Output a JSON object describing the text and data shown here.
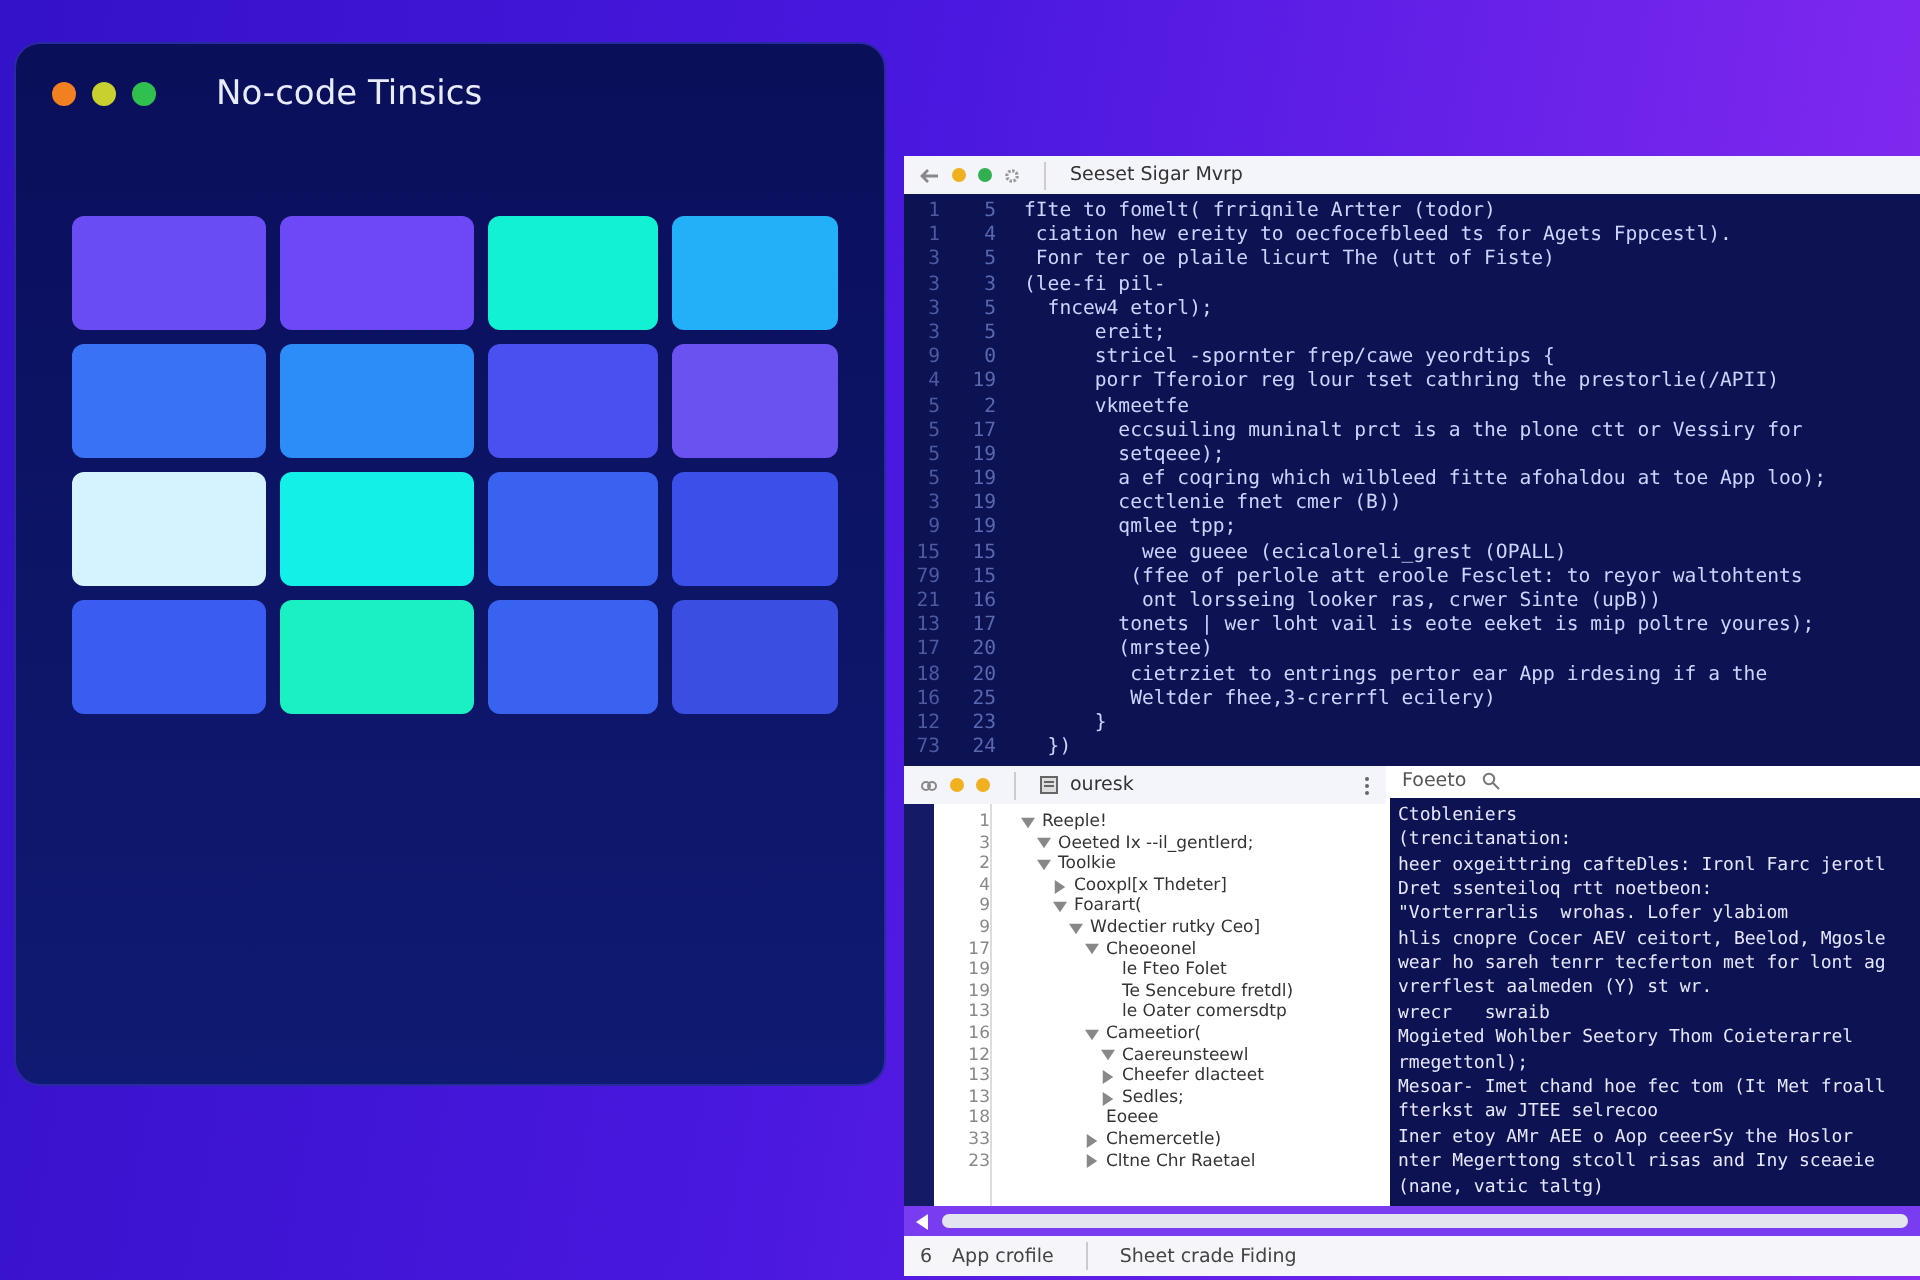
{
  "app_window": {
    "title": "No-code Tinsics",
    "tiles": [
      {
        "color": "#6a4cf5"
      },
      {
        "color": "#6c48f6"
      },
      {
        "color": "#12f2d2"
      },
      {
        "color": "#22b0f8"
      },
      {
        "color": "#3a72f5"
      },
      {
        "color": "#2c8cf8"
      },
      {
        "color": "#4a50f0"
      },
      {
        "color": "#6a52f0"
      },
      {
        "color": "#d4f2ff"
      },
      {
        "color": "#12f0e8"
      },
      {
        "color": "#3a62f0"
      },
      {
        "color": "#3a50e8"
      },
      {
        "color": "#3a5cf0"
      },
      {
        "color": "#1af0c2"
      },
      {
        "color": "#3a62f0"
      },
      {
        "color": "#3a4ee2"
      }
    ]
  },
  "editor": {
    "title": "Seeset Sigar Mvrp",
    "lines": [
      {
        "n1": "1",
        "n2": "5",
        "text": "fIte to fomelt( frriqnile Artter (todor)"
      },
      {
        "n1": "1",
        "n2": "4",
        "text": " ciation hew ereity to oecfocefbleed ts for Agets Fppcestl)."
      },
      {
        "n1": "3",
        "n2": "5",
        "text": " Fonr ter oe plaile licurt The (utt of Fiste)"
      },
      {
        "n1": "3",
        "n2": "3",
        "text": "(lee-fi pil-"
      },
      {
        "n1": "3",
        "n2": "5",
        "text": "  fncew4 etorl);"
      },
      {
        "n1": "3",
        "n2": "5",
        "text": "      ereit;"
      },
      {
        "n1": "9",
        "n2": "0",
        "text": "      stricel -spornter frep/cawe yeordtips {"
      },
      {
        "n1": "4",
        "n2": "19",
        "text": "      porr Tferoior reg lour tset cathring the prestorlie(/APII)"
      },
      {
        "n1": "5",
        "n2": "2",
        "text": "      vkmeetfe"
      },
      {
        "n1": "5",
        "n2": "17",
        "text": "        eccsuiling muninalt prct is a the plone ctt or Vessiry for"
      },
      {
        "n1": "5",
        "n2": "19",
        "text": "        setqeee);"
      },
      {
        "n1": "5",
        "n2": "19",
        "text": "        a ef coqring which wilbleed fitte afohaldou at toe App loo);"
      },
      {
        "n1": "3",
        "n2": "19",
        "text": "        cectlenie fnet cmer (B))"
      },
      {
        "n1": "9",
        "n2": "19",
        "text": "        qmlee tpp;"
      },
      {
        "n1": "15",
        "n2": "15",
        "text": "          wee gueee (ecicaloreli_grest (OPALL)"
      },
      {
        "n1": "79",
        "n2": "15",
        "text": "         (ffee of perlole att eroole Fesclet: to reyor waltohtents"
      },
      {
        "n1": "21",
        "n2": "16",
        "text": "          ont lorsseing looker ras, crwer Sinte (upB))"
      },
      {
        "n1": "13",
        "n2": "17",
        "text": "        tonets | wer loht vail is eote eeket is mip poltre youres);"
      },
      {
        "n1": "17",
        "n2": "20",
        "text": "        (mrstee)"
      },
      {
        "n1": "18",
        "n2": "20",
        "text": "         cietrziet to entrings pertor ear App irdesing if a the"
      },
      {
        "n1": "16",
        "n2": "25",
        "text": "         Weltder fhee,3-crerrfl ecilery)"
      },
      {
        "n1": "12",
        "n2": "23",
        "text": "      }"
      },
      {
        "n1": "73",
        "n2": "24",
        "text": "  })"
      }
    ]
  },
  "outline": {
    "title": "ouresk",
    "items": [
      {
        "line": "1",
        "label": "Reeple!",
        "expanded": true,
        "children": [
          {
            "line": "3",
            "label": "Oeeted Ix --il_gentlerd;",
            "expanded": true
          },
          {
            "line": "2",
            "label": "Toolkie",
            "expanded": true,
            "children": [
              {
                "line": "4",
                "label": "Cooxpl[x Thdeter]",
                "expanded": false
              },
              {
                "line": "9",
                "label": "Foarart(",
                "expanded": true,
                "children": [
                  {
                    "line": "9",
                    "label": "Wdectier rutky Ceo]",
                    "expanded": true,
                    "children": [
                      {
                        "line": "17",
                        "label": "Cheoeonel",
                        "expanded": true,
                        "children": [
                          {
                            "line": "19",
                            "label": "le Fteo Folet"
                          },
                          {
                            "line": "19",
                            "label": "Te Sencebure fretdl)"
                          },
                          {
                            "line": "13",
                            "label": "le Oater comersdtp"
                          }
                        ]
                      },
                      {
                        "line": "16",
                        "label": "Cameetior(",
                        "expanded": true,
                        "children": [
                          {
                            "line": "12",
                            "label": "Caereunsteewl",
                            "expanded": true
                          },
                          {
                            "line": "13",
                            "label": "Cheefer dlacteet",
                            "expanded": false
                          },
                          {
                            "line": "13",
                            "label": "Sedles;",
                            "expanded": false
                          }
                        ]
                      },
                      {
                        "line": "18",
                        "label": "Eoeee"
                      },
                      {
                        "line": "33",
                        "label": "Chemercetle)",
                        "expanded": false
                      },
                      {
                        "line": "23",
                        "label": "Cltne Chr Raetael",
                        "expanded": false
                      }
                    ]
                  }
                ]
              }
            ]
          }
        ]
      }
    ]
  },
  "console": {
    "title": "Foeeto",
    "lines": [
      "Ctobleniers",
      "(trencitanation:",
      "heer oxgeittring cafteDles: Ironl Farc jerotl",
      "Dret ssenteiloq rtt noetbeon:",
      "\"Vorterrarlis  wrohas. Lofer ylabiom",
      "hlis cnopre Cocer AEV ceitort, Beelod, Mgosle",
      "wear ho sareh tenrr tecferton met for lont ag",
      "vrerflest aalmeden (Y) st wr.",
      "wrecr   swraib",
      "Mogieted Wohlber Seetory Thom Coieterarrel",
      "rmegettonl);",
      "Mesoar- Imet chand hoe fec tom (It Met froall",
      "fterkst aw JTEE selrecoo",
      "Iner etoy AMr AEE o Aop ceeerSy the Hoslor",
      "nter Megerttong stcoll risas and Iny sceaeie",
      "(nane, vatic taltg)"
    ]
  },
  "status_bar": {
    "count": "6",
    "items": [
      "App crofile",
      "Sheet crade Fiding"
    ]
  }
}
